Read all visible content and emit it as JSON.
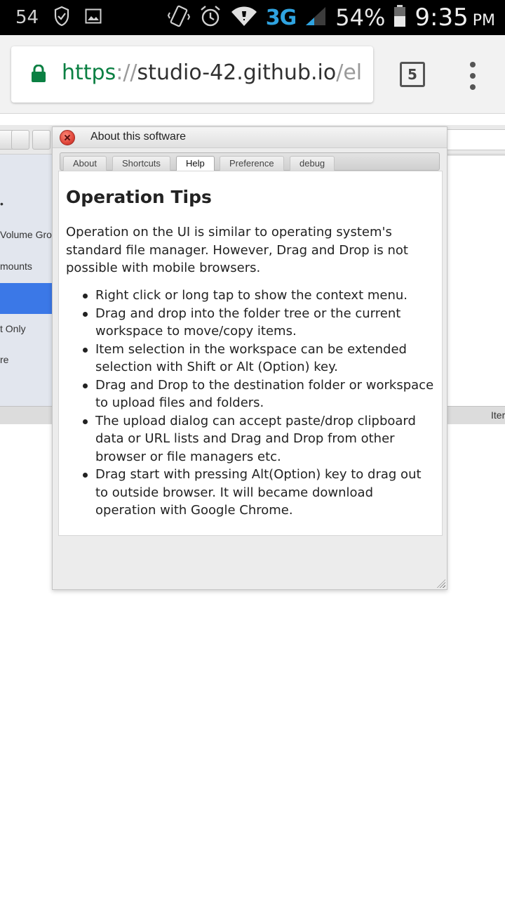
{
  "status_bar": {
    "notification_count": "54",
    "network": "3G",
    "battery": "54%",
    "time": "9:35",
    "ampm": "PM"
  },
  "browser": {
    "url_scheme": "https",
    "url_separator": "://",
    "url_host": "studio-42.github.io",
    "url_path": "/el",
    "tab_count": "5"
  },
  "background_app": {
    "sidebar_items": [
      "Volume Grou",
      "mounts",
      "t Only",
      "re"
    ],
    "status_right": "Iter"
  },
  "dialog": {
    "title": "About this software",
    "tabs": [
      "About",
      "Shortcuts",
      "Help",
      "Preference",
      "debug"
    ],
    "active_tab": "Help",
    "heading": "Operation Tips",
    "intro": "Operation on the UI is similar to operating system's standard file manager. However, Drag and Drop is not possible with mobile browsers.",
    "tips": [
      "Right click or long tap to show the context menu.",
      "Drag and drop into the folder tree or the current workspace to move/copy items.",
      "Item selection in the workspace can be extended selection with Shift or Alt (Option) key.",
      "Drag and Drop to the destination folder or workspace to upload files and folders.",
      "The upload dialog can accept paste/drop clipboard data or URL lists and Drag and Drop from other browser or file managers etc.",
      "Drag start with pressing Alt(Option) key to drag out to outside browser. It will became download operation with Google Chrome."
    ]
  },
  "colors": {
    "url_scheme": "#0b8043",
    "network_3g": "#2fa3e0",
    "sidebar_selected": "#3b78e7",
    "close_button": "#e0463a"
  }
}
